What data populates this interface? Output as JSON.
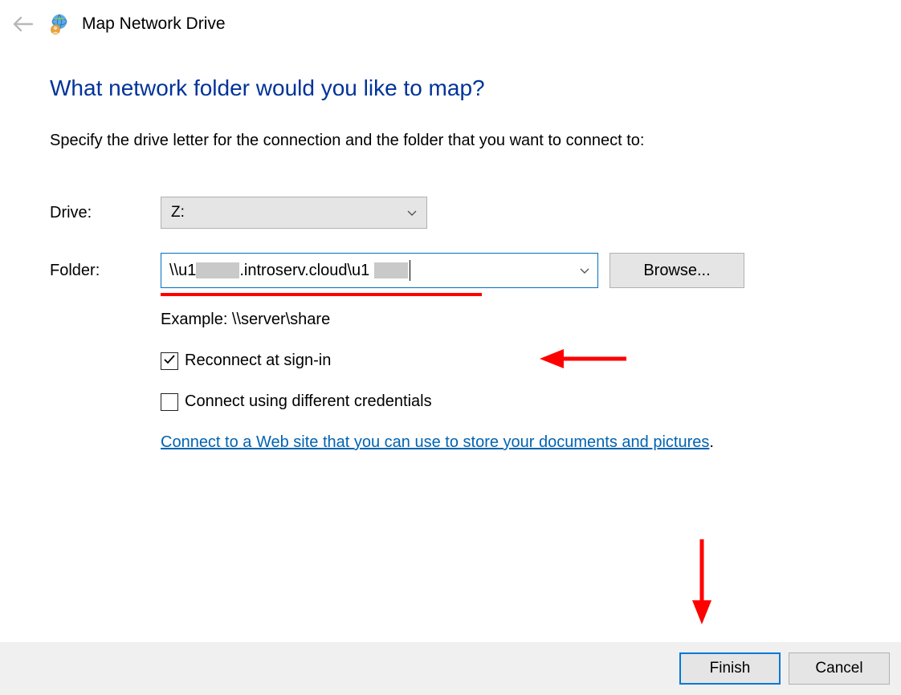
{
  "header": {
    "title": "Map Network Drive"
  },
  "content": {
    "heading": "What network folder would you like to map?",
    "instruction": "Specify the drive letter for the connection and the folder that you want to connect to:",
    "drive_label": "Drive:",
    "drive_value": "Z:",
    "folder_label": "Folder:",
    "folder_value_prefix": "\\\\u1",
    "folder_value_mid": ".introserv.cloud\\u1",
    "browse_label": "Browse...",
    "example_text": "Example: \\\\server\\share",
    "reconnect_label": "Reconnect at sign-in",
    "reconnect_checked": true,
    "diffcred_label": "Connect using different credentials",
    "diffcred_checked": false,
    "link_text": "Connect to a Web site that you can use to store your documents and pictures"
  },
  "footer": {
    "finish_label": "Finish",
    "cancel_label": "Cancel"
  },
  "annotations": {
    "underline_color": "#ff0000",
    "arrow_color": "#ff0000"
  }
}
